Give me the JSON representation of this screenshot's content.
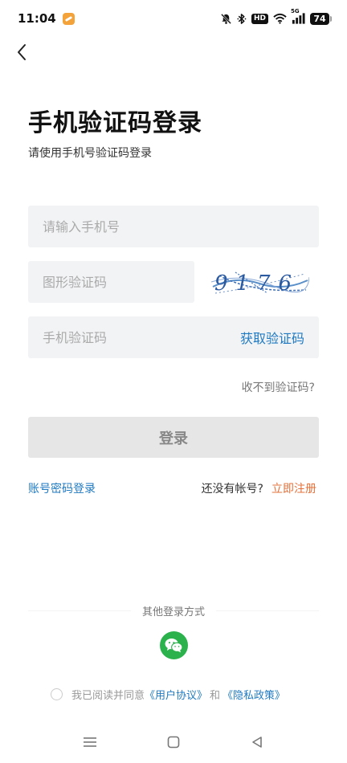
{
  "status_bar": {
    "time": "11:04",
    "network": "5G",
    "hd": "HD",
    "battery": "74",
    "icons": [
      "app-notification-icon",
      "bell-muted-icon",
      "bluetooth-icon",
      "hd-icon",
      "wifi-icon",
      "signal-5g-icon",
      "battery-icon"
    ]
  },
  "header": {
    "back_icon": "chevron-left-icon",
    "title": "手机验证码登录",
    "subtitle": "请使用手机号验证码登录"
  },
  "form": {
    "phone_placeholder": "请输入手机号",
    "phone_value": "",
    "captcha_placeholder": "图形验证码",
    "captcha_value": "",
    "captcha_image_text": "9176",
    "sms_placeholder": "手机验证码",
    "sms_value": "",
    "get_code_label": "获取验证码",
    "no_code_label": "收不到验证码?",
    "login_label": "登录"
  },
  "links": {
    "password_login": "账号密码登录",
    "no_account": "还没有帐号?",
    "register": "立即注册"
  },
  "other_login": {
    "label": "其他登录方式",
    "wechat_icon": "wechat-icon"
  },
  "agreement": {
    "prefix": "我已阅读并同意",
    "user_agreement": "《用户协议》",
    "and": "和",
    "privacy_policy": "《隐私政策》",
    "checked": false
  },
  "colors": {
    "link_blue": "#1f7ac2",
    "register_orange": "#e5703a",
    "input_bg": "#f2f3f5",
    "button_disabled_bg": "#e6e6e6",
    "wechat_green": "#2bb24c"
  },
  "nav_bar": {
    "icons": [
      "menu-icon",
      "home-square-icon",
      "back-triangle-icon"
    ]
  }
}
